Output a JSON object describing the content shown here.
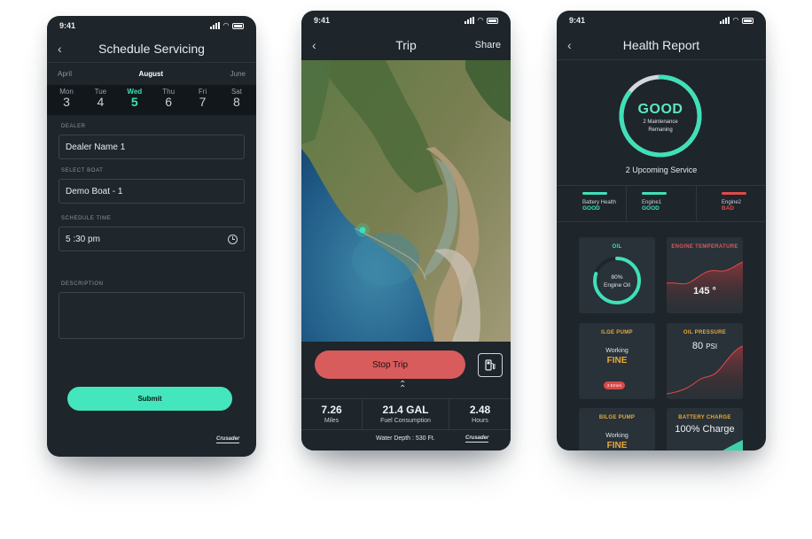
{
  "status_bar": {
    "time": "9:41"
  },
  "schedule": {
    "title": "Schedule Servicing",
    "back": "‹",
    "months": [
      "April",
      "August",
      "June"
    ],
    "active_month_index": 1,
    "days": [
      {
        "name": "Mon",
        "num": "3"
      },
      {
        "name": "Tue",
        "num": "4"
      },
      {
        "name": "Wed",
        "num": "5"
      },
      {
        "name": "Thu",
        "num": "6"
      },
      {
        "name": "Fri",
        "num": "7"
      },
      {
        "name": "Sat",
        "num": "8"
      }
    ],
    "selected_day_index": 2,
    "dealer_label": "DEALER",
    "dealer_value": "Dealer Name 1",
    "boat_label": "SELECT BOAT",
    "boat_value": "Demo Boat - 1",
    "time_label": "SCHEDULE TIME",
    "time_value": "5 :30 pm",
    "description_label": "DESCRIPTION",
    "description_value": "",
    "submit_label": "Submit",
    "brand": "Crusader"
  },
  "trip": {
    "title": "Trip",
    "back": "‹",
    "share_label": "Share",
    "stop_label": "Stop Trip",
    "expand_glyph": "⌃",
    "stats": [
      {
        "value": "7.26",
        "label": "Miles"
      },
      {
        "value": "21.4 GAL",
        "label": "Fuel Consumption"
      },
      {
        "value": "2.48",
        "label": "Hours"
      }
    ],
    "water_depth": "Water Depth : 530 Ft.",
    "brand": "Crusader"
  },
  "health": {
    "title": "Health Report",
    "back": "‹",
    "overall": "GOOD",
    "overall_sub1": "2 Maintenance",
    "overall_sub2": "Remaning",
    "overall_fraction": 0.85,
    "upcoming": "2 Upcoming Service",
    "components": [
      {
        "name": "Battery Health",
        "status": "GOOD",
        "color": "#3fe0b8"
      },
      {
        "name": "Engine1",
        "status": "GOOD",
        "color": "#3fe0b8"
      },
      {
        "name": "Engine2",
        "status": "BAD",
        "color": "#e04b4b"
      }
    ],
    "oil": {
      "title": "OIL",
      "percent": "80%",
      "label": "Engine Oil",
      "fraction": 0.8
    },
    "engine_temp": {
      "title": "ENGINE TEMPERATURE",
      "value": "145 °"
    },
    "ilge_pump": {
      "title": "ILGE PUMP",
      "state": "Working",
      "status": "FINE",
      "badge": "2 Errors"
    },
    "oil_pressure": {
      "title": "OIL PRESSURE",
      "value": "80",
      "unit": "PSI"
    },
    "bilge_pump": {
      "title": "BILGE PUMP",
      "state": "Working",
      "status": "FINE"
    },
    "battery_charge": {
      "title": "BATTERY CHARGE",
      "value": "100% Charge"
    }
  },
  "colors": {
    "accent": "#43e6bd",
    "danger": "#d85c5c",
    "warning": "#e8a93c",
    "panel": "#1e252b"
  }
}
